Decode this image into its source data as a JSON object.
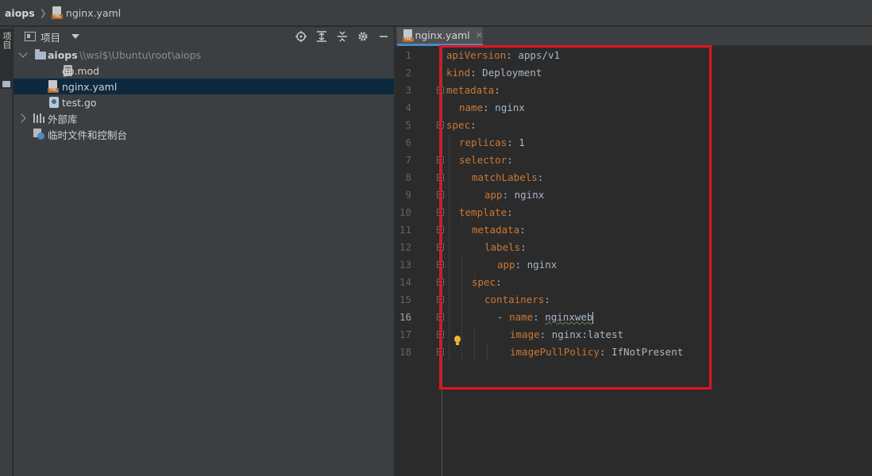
{
  "breadcrumb": {
    "root": "aiops",
    "file": "nginx.yaml"
  },
  "left_strip": {
    "label": "项目"
  },
  "project_panel": {
    "title": "项目",
    "tools": [
      "locate-icon",
      "expand-all-icon",
      "collapse-all-icon",
      "gear-icon",
      "minimize-icon"
    ],
    "tree": [
      {
        "label": "aiops",
        "path": "\\\\wsl$\\Ubuntu\\root\\aiops",
        "type": "folder",
        "expanded": true
      },
      {
        "label": "go.mod",
        "type": "file"
      },
      {
        "label": "nginx.yaml",
        "type": "yaml",
        "selected": true
      },
      {
        "label": "test.go",
        "type": "go"
      },
      {
        "label": "外部库",
        "type": "library",
        "expanded": false
      },
      {
        "label": "临时文件和控制台",
        "type": "scratches"
      }
    ]
  },
  "editor": {
    "tab": {
      "label": "nginx.yaml",
      "close": "✕"
    },
    "current_line": 16,
    "lines": [
      {
        "n": "1",
        "key": "apiVersion",
        "val": " apps/v1"
      },
      {
        "n": "2",
        "key": "kind",
        "val": " Deployment"
      },
      {
        "n": "3",
        "key": "metadata",
        "val": ""
      },
      {
        "n": "4",
        "key": "name",
        "val": " nginx"
      },
      {
        "n": "5",
        "key": "spec",
        "val": ""
      },
      {
        "n": "6",
        "key": "replicas",
        "val": " 1"
      },
      {
        "n": "7",
        "key": "selector",
        "val": ""
      },
      {
        "n": "8",
        "key": "matchLabels",
        "val": ""
      },
      {
        "n": "9",
        "key": "app",
        "val": " nginx"
      },
      {
        "n": "10",
        "key": "template",
        "val": ""
      },
      {
        "n": "11",
        "key": "metadata",
        "val": ""
      },
      {
        "n": "12",
        "key": "labels",
        "val": ""
      },
      {
        "n": "13",
        "key": "app",
        "val": " nginx"
      },
      {
        "n": "14",
        "key": "spec",
        "val": ""
      },
      {
        "n": "15",
        "key": "containers",
        "val": ""
      },
      {
        "n": "16",
        "key": "name",
        "val": " nginxweb",
        "dash": "- "
      },
      {
        "n": "17",
        "key": "image",
        "val": " nginx:latest"
      },
      {
        "n": "18",
        "key": "imagePullPolicy",
        "val": " IfNotPresent"
      }
    ]
  },
  "colors": {
    "key": "#cc7832",
    "value": "#a9b7c6",
    "annotation_box": "#e0141e",
    "selection": "#0d293e"
  }
}
